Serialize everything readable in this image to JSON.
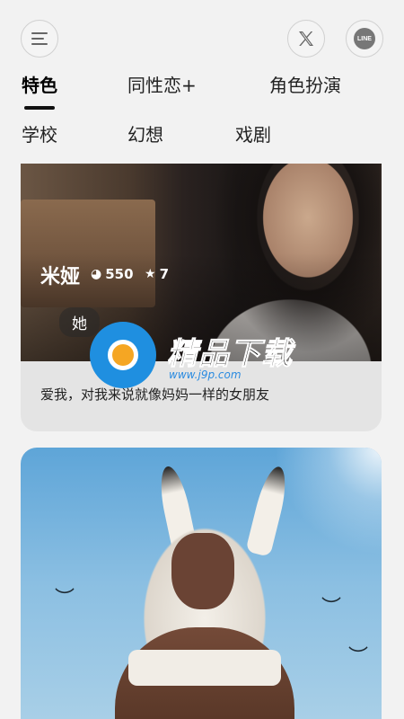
{
  "top_bar": {
    "menu_icon": "menu-icon",
    "x_icon": "x-logo-icon",
    "line_label": "LINE"
  },
  "tabs": [
    {
      "label": "特色",
      "active": true
    },
    {
      "label": "同性恋+",
      "active": false
    },
    {
      "label": "角色扮演",
      "active": false
    },
    {
      "label": "学校",
      "active": false
    },
    {
      "label": "幻想",
      "active": false
    },
    {
      "label": "戏剧",
      "active": false
    }
  ],
  "cards": [
    {
      "name": "米娅",
      "chats": "550",
      "likes": "7",
      "tag": "她",
      "description": "爱我，对我来说就像妈妈一样的女朋友"
    }
  ],
  "watermark": {
    "title": "精品下载",
    "url": "www.j9p.com"
  },
  "colors": {
    "background": "#f2f2f2",
    "active_tab": "#111111",
    "watermark_blue": "#1f8fe0",
    "watermark_orange": "#f5a623"
  }
}
